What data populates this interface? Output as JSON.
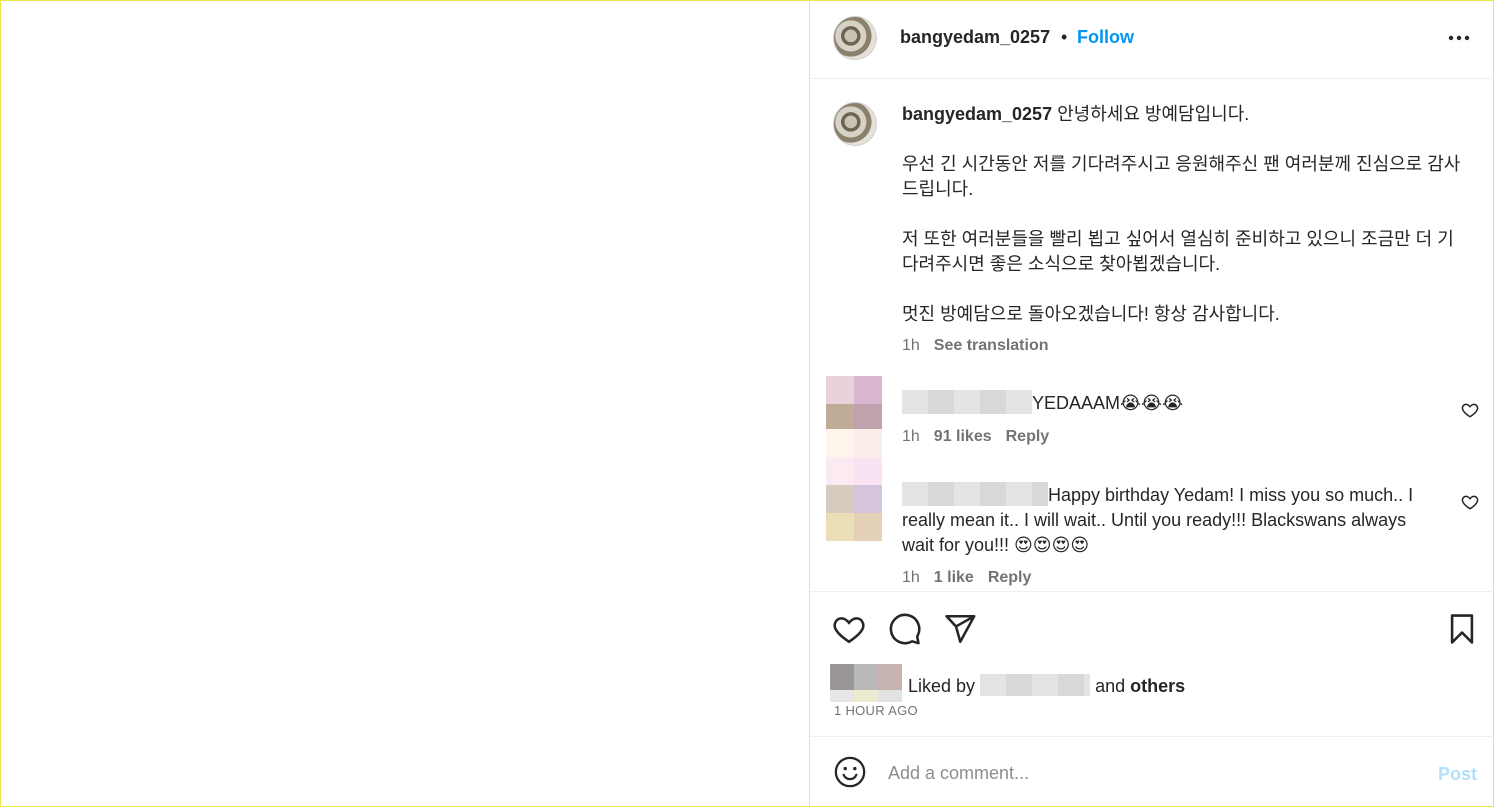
{
  "header": {
    "username": "bangyedam_0257",
    "separator": "•",
    "follow_label": "Follow"
  },
  "caption": {
    "username": "bangyedam_0257",
    "text": "안녕하세요 방예담입니다.\n\n우선 긴 시간동안 저를 기다려주시고 응원해주신 팬 여러분께 진심으로 감사드립니다.\n\n저 또한 여러분들을 빨리 뵙고 싶어서 열심히 준비하고 있으니 조금만 더 기다려주시면 좋은 소식으로 찾아뵙겠습니다.\n\n멋진 방예담으로 돌아오겠습니다! 항상 감사합니다.",
    "time": "1h",
    "see_translation": "See translation"
  },
  "comments": [
    {
      "text": "YEDAAAM😭😭😭",
      "time": "1h",
      "likes": "91 likes",
      "reply": "Reply"
    },
    {
      "text": "Happy birthday Yedam! I miss you so much.. I really mean it.. I will wait.. Until you ready!!! Blackswans always wait for you!!! 😍😍😍😍",
      "time": "1h",
      "likes": "1 like",
      "reply": "Reply"
    }
  ],
  "likes": {
    "prefix": "Liked by",
    "middle": "and",
    "others": "others"
  },
  "timestamp": "1 HOUR AGO",
  "comment_box": {
    "placeholder": "Add a comment...",
    "post_label": "Post"
  },
  "colors": {
    "accent": "#0095f6",
    "post_disabled": "#b2dffc",
    "meta_gray": "#737373"
  }
}
